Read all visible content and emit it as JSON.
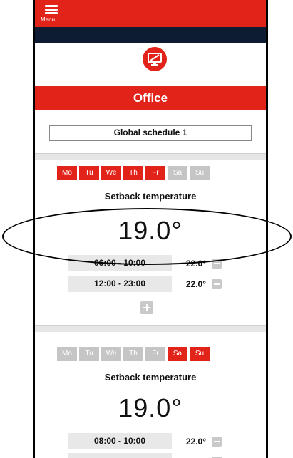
{
  "header": {
    "menu_label": "Menu"
  },
  "room": {
    "name": "Office",
    "icon": "monitor-icon"
  },
  "schedule": {
    "name": "Global schedule 1"
  },
  "blocks": [
    {
      "days": [
        {
          "label": "Mo",
          "active": true
        },
        {
          "label": "Tu",
          "active": true
        },
        {
          "label": "We",
          "active": true
        },
        {
          "label": "Th",
          "active": true
        },
        {
          "label": "Fr",
          "active": true
        },
        {
          "label": "Sa",
          "active": false
        },
        {
          "label": "Su",
          "active": false
        }
      ],
      "title": "Setback temperature",
      "setback": "19.0°",
      "periods": [
        {
          "time": "06:00 - 10:00",
          "temp": "22.0°"
        },
        {
          "time": "12:00 - 23:00",
          "temp": "22.0°"
        }
      ]
    },
    {
      "days": [
        {
          "label": "Mo",
          "active": false
        },
        {
          "label": "Tu",
          "active": false
        },
        {
          "label": "We",
          "active": false
        },
        {
          "label": "Th",
          "active": false
        },
        {
          "label": "Fr",
          "active": false
        },
        {
          "label": "Sa",
          "active": true
        },
        {
          "label": "Su",
          "active": true
        }
      ],
      "title": "Setback temperature",
      "setback": "19.0°",
      "periods": [
        {
          "time": "08:00 - 10:00",
          "temp": "22.0°"
        }
      ]
    }
  ],
  "colors": {
    "accent": "#e2231a",
    "navy": "#0d1c33",
    "inactive": "#c5c5c5"
  }
}
